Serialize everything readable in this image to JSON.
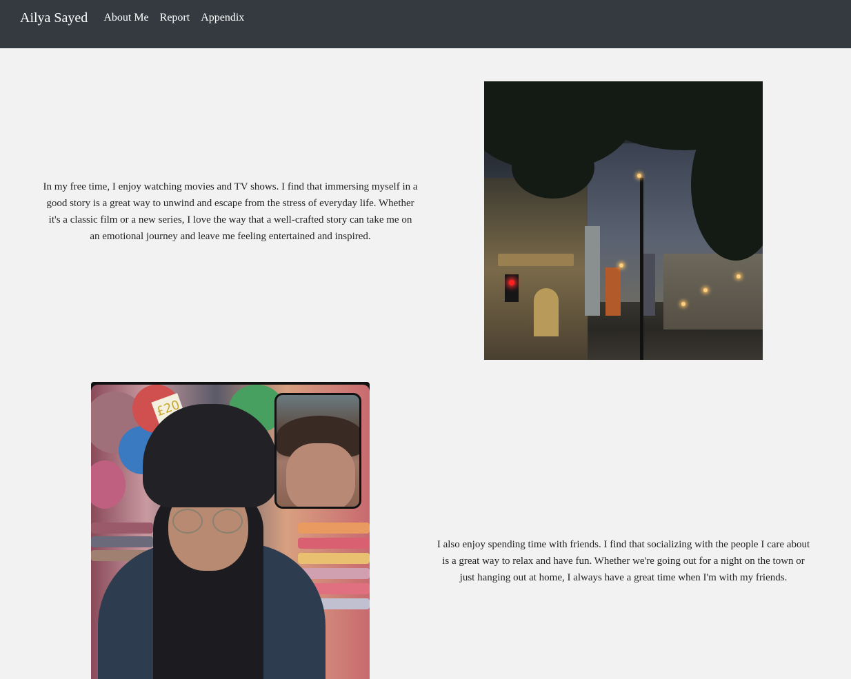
{
  "navbar": {
    "brand": "Ailya Sayed",
    "links": [
      {
        "label": "About Me"
      },
      {
        "label": "Report"
      },
      {
        "label": "Appendix"
      }
    ]
  },
  "sections": [
    {
      "text": "In my free time, I enjoy watching movies and TV shows. I find that immersing myself in a good story is a great way to unwind and escape from the stress of everyday life. Whether it's a classic film or a new series, I love the way that a well-crafted story can take me on an emotional journey and leave me feeling entertained and inspired.",
      "image": "street-at-dusk-photo"
    },
    {
      "text": "I also enjoy spending time with friends. I find that socializing with the people I care about is a great way to relax and have fun. Whether we're going out for a night on the town or just hanging out at home, I always have a great time when I'm with my friends.",
      "image": "selfie-with-friend-photo",
      "price_tag": "£20"
    }
  ],
  "colors": {
    "navbar_bg": "#343a40",
    "page_bg": "#f2f2f2",
    "nav_text": "#ffffff",
    "body_text": "#222222"
  }
}
